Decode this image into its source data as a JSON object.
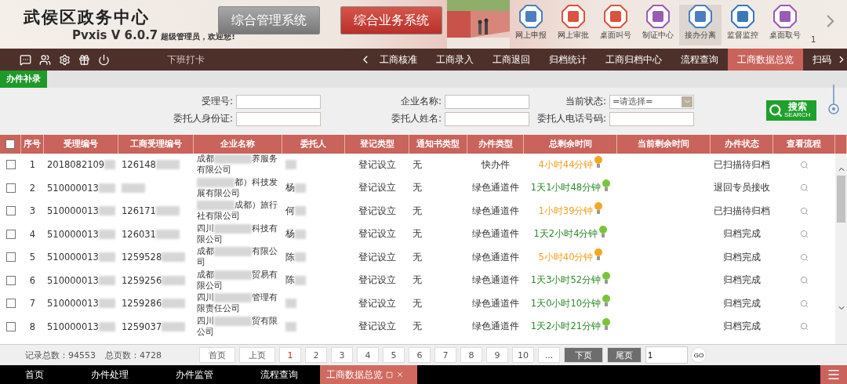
{
  "header": {
    "title": "武侯区政务中心",
    "version": "Pvxis V 6.0.7",
    "welcome": "超级管理员，欢迎您!",
    "systems": [
      {
        "label": "综合管理系统",
        "selected": false
      },
      {
        "label": "综合业务系统",
        "selected": true
      }
    ],
    "apps": [
      {
        "label": "网上申报",
        "color": "#4a7fc0",
        "selected": false
      },
      {
        "label": "网上审批",
        "color": "#d9533f",
        "selected": false
      },
      {
        "label": "桌面叫号",
        "color": "#d9533f",
        "selected": false
      },
      {
        "label": "制证中心",
        "color": "#9a5bb5",
        "selected": false
      },
      {
        "label": "接办分离",
        "color": "#4a7fc0",
        "selected": true
      },
      {
        "label": "监督监控",
        "color": "#3a78b8",
        "selected": false
      },
      {
        "label": "桌面取号",
        "color": "#9a5bb5",
        "selected": false
      }
    ],
    "page": "1"
  },
  "nav": {
    "clock_label": "下班打卡",
    "tabs": [
      {
        "label": "工商核准",
        "selected": false
      },
      {
        "label": "工商录入",
        "selected": false
      },
      {
        "label": "工商退回",
        "selected": false
      },
      {
        "label": "归档统计",
        "selected": false
      },
      {
        "label": "工商归档中心",
        "selected": false
      },
      {
        "label": "流程查询",
        "selected": false
      },
      {
        "label": "工商数据总览",
        "selected": true
      },
      {
        "label": "扫码",
        "selected": false
      }
    ]
  },
  "subtab": "办件补录",
  "filters": [
    {
      "label": "受理号:"
    },
    {
      "label": "企业名称:"
    },
    {
      "label": "当前状态:",
      "kind": "select",
      "value": "=请选择="
    },
    {
      "label": "委托人身份证:"
    },
    {
      "label": "委托人姓名:"
    },
    {
      "label": "委托人电话号码:"
    }
  ],
  "search_button": {
    "label": "搜索",
    "sub": "SEARCH"
  },
  "table": {
    "all_checked": false,
    "columns": [
      "序号",
      "受理编号",
      "工商受理编号",
      "企业名称",
      "委托人",
      "登记类型",
      "通知书类型",
      "办件类型",
      "总剩余时间",
      "当前剩余时间",
      "办件状态",
      "查看流程"
    ],
    "rows": [
      {
        "checked": false,
        "no": "1",
        "accept": "2018082109",
        "biz": "126148",
        "company": {
          "prefix": "成都",
          "suffix": "养服务有限公司"
        },
        "agent": "",
        "reg": "登记设立",
        "notice": "无",
        "type": "快办件",
        "time": "4小时44分钟",
        "kind": "warning",
        "status": "已扫描待归档"
      },
      {
        "checked": false,
        "no": "2",
        "accept": "510000013",
        "biz": "",
        "company": {
          "suffix": "都）科技发展有限公司"
        },
        "agent": "杨",
        "reg": "登记设立",
        "notice": "无",
        "type": "绿色通道件",
        "time": "1天1小时48分钟",
        "kind": "normal",
        "status": "退回专员接收"
      },
      {
        "checked": false,
        "no": "3",
        "accept": "510000013",
        "biz": "126171",
        "company": {
          "suffix": "成都）旅行社有限公司"
        },
        "agent": "何",
        "reg": "登记设立",
        "notice": "无",
        "type": "绿色通道件",
        "time": "1小时39分钟",
        "kind": "warning",
        "status": "已扫描待归档"
      },
      {
        "checked": false,
        "no": "4",
        "accept": "510000013",
        "biz": "126031",
        "company": {
          "prefix": "四川",
          "suffix": "科技有限公司"
        },
        "agent": "杨",
        "reg": "登记设立",
        "notice": "无",
        "type": "绿色通道件",
        "time": "1天2小时4分钟",
        "kind": "normal",
        "status": "归档完成"
      },
      {
        "checked": false,
        "no": "5",
        "accept": "510000013",
        "biz": "1259528",
        "company": {
          "prefix": "成都",
          "suffix": "有限公司"
        },
        "agent": "陈",
        "reg": "登记设立",
        "notice": "无",
        "type": "绿色通道件",
        "time": "5小时40分钟",
        "kind": "warning",
        "status": "归档完成"
      },
      {
        "checked": false,
        "no": "6",
        "accept": "510000013",
        "biz": "1259256",
        "company": {
          "prefix": "成都",
          "suffix": "贸易有限公司"
        },
        "agent": "陈",
        "reg": "登记设立",
        "notice": "无",
        "type": "绿色通道件",
        "time": "1天3小时52分钟",
        "kind": "normal",
        "status": "归档完成"
      },
      {
        "checked": false,
        "no": "7",
        "accept": "510000013",
        "biz": "1259286",
        "company": {
          "prefix": "四川",
          "suffix": "管理有限责任公司"
        },
        "agent": "",
        "reg": "登记设立",
        "notice": "无",
        "type": "绿色通道件",
        "time": "1天0小时10分钟",
        "kind": "normal",
        "status": "归档完成"
      },
      {
        "checked": false,
        "no": "8",
        "accept": "510000013",
        "biz": "1259037",
        "company": {
          "prefix": "四川",
          "suffix": "贸有限公司"
        },
        "agent": "",
        "reg": "登记设立",
        "notice": "无",
        "type": "绿色通道件",
        "time": "1天2小时21分钟",
        "kind": "normal",
        "status": "归档完成"
      }
    ]
  },
  "summary": {
    "records": "记录总数：94553",
    "pages": "总页数：4728"
  },
  "pager": {
    "first": "首页",
    "prev": "上页",
    "pages": [
      {
        "label": "1",
        "selected": true
      },
      {
        "label": "2",
        "selected": false
      },
      {
        "label": "3",
        "selected": false
      },
      {
        "label": "4",
        "selected": false
      },
      {
        "label": "5",
        "selected": false
      },
      {
        "label": "6",
        "selected": false
      },
      {
        "label": "7",
        "selected": false
      },
      {
        "label": "8",
        "selected": false
      },
      {
        "label": "9",
        "selected": false
      },
      {
        "label": "10",
        "selected": false
      },
      {
        "label": "...",
        "selected": false
      }
    ],
    "next": "下页",
    "last": "尾页",
    "goto": "1",
    "go": "GO"
  },
  "taskbar": [
    {
      "label": "首页",
      "selected": false
    },
    {
      "label": "办件处理",
      "selected": false
    },
    {
      "label": "办件监管",
      "selected": false
    },
    {
      "label": "流程查询",
      "selected": false
    },
    {
      "label": "工商数据总览",
      "selected": true
    }
  ]
}
